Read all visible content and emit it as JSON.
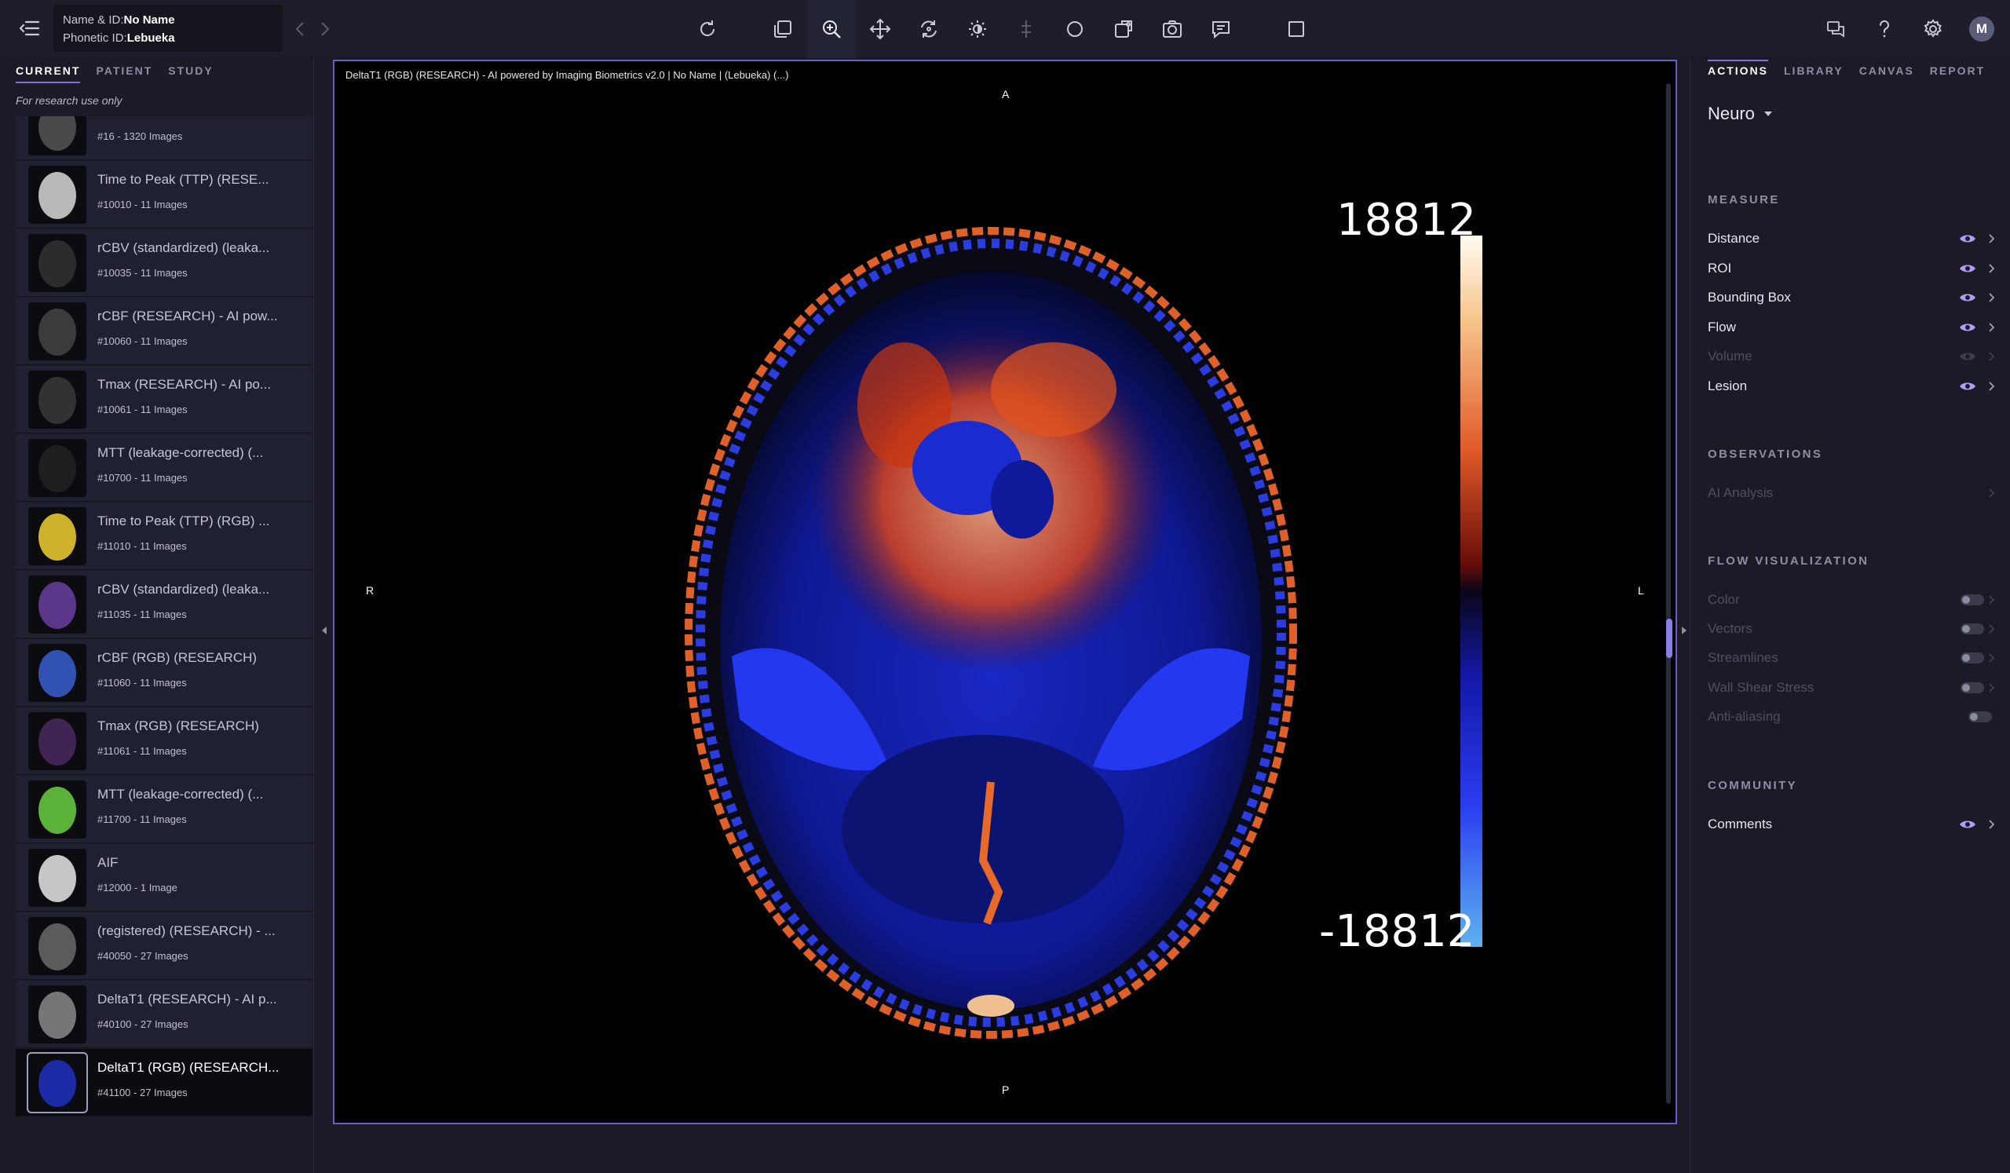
{
  "header": {
    "name_label": "Name & ID:",
    "name_value": "No Name",
    "phonetic_label": "Phonetic ID:",
    "phonetic_value": "Lebueka",
    "user_initial": "M"
  },
  "left_panel": {
    "tabs": [
      "CURRENT",
      "PATIENT",
      "STUDY"
    ],
    "research_note": "For research use only",
    "series": [
      {
        "title": "",
        "subtitle": "#16 - 1320 Images"
      },
      {
        "title": "Time to Peak (TTP) (RESE...",
        "subtitle": "#10010 - 11 Images"
      },
      {
        "title": "rCBV (standardized) (leaka...",
        "subtitle": "#10035 - 11 Images"
      },
      {
        "title": "rCBF (RESEARCH) - AI pow...",
        "subtitle": "#10060 - 11 Images"
      },
      {
        "title": "Tmax (RESEARCH) - AI po...",
        "subtitle": "#10061 - 11 Images"
      },
      {
        "title": "MTT (leakage-corrected) (...",
        "subtitle": "#10700 - 11 Images"
      },
      {
        "title": "Time to Peak (TTP) (RGB) ...",
        "subtitle": "#11010 - 11 Images"
      },
      {
        "title": "rCBV (standardized) (leaka...",
        "subtitle": "#11035 - 11 Images"
      },
      {
        "title": "rCBF (RGB) (RESEARCH)",
        "subtitle": "#11060 - 11 Images"
      },
      {
        "title": "Tmax (RGB) (RESEARCH)",
        "subtitle": "#11061 - 11 Images"
      },
      {
        "title": "MTT (leakage-corrected) (...",
        "subtitle": "#11700 - 11 Images"
      },
      {
        "title": "AIF",
        "subtitle": "#12000 - 1 Image"
      },
      {
        "title": "(registered) (RESEARCH) - ...",
        "subtitle": "#40050 - 27 Images"
      },
      {
        "title": "DeltaT1 (RESEARCH) - AI p...",
        "subtitle": "#40100 - 27 Images"
      },
      {
        "title": "DeltaT1 (RGB) (RESEARCH...",
        "subtitle": "#41100 - 27 Images"
      }
    ]
  },
  "viewport": {
    "header": "DeltaT1 (RGB) (RESEARCH) - AI powered by Imaging Biometrics v2.0 | No Name | (Lebueka) (...)",
    "orient_top": "A",
    "orient_bottom": "P",
    "orient_left": "R",
    "orient_right": "L",
    "colorbar_max": "18812",
    "colorbar_min": "-18812"
  },
  "right_panel": {
    "tabs": [
      "ACTIONS",
      "LIBRARY",
      "CANVAS",
      "REPORT"
    ],
    "mode": "Neuro",
    "measure_title": "MEASURE",
    "measure_items": [
      "Distance",
      "ROI",
      "Bounding Box",
      "Flow",
      "Volume",
      "Lesion"
    ],
    "observations_title": "OBSERVATIONS",
    "observation_items": [
      "AI Analysis"
    ],
    "flow_title": "FLOW VISUALIZATION",
    "flow_items": [
      "Color",
      "Vectors",
      "Streamlines",
      "Wall Shear Stress",
      "Anti-aliasing"
    ],
    "community_title": "COMMUNITY",
    "community_items": [
      "Comments"
    ]
  },
  "colors": {
    "accent": "#7d72d8",
    "eye": "#b49cf5",
    "viewport_border": "#6f5ac8"
  }
}
